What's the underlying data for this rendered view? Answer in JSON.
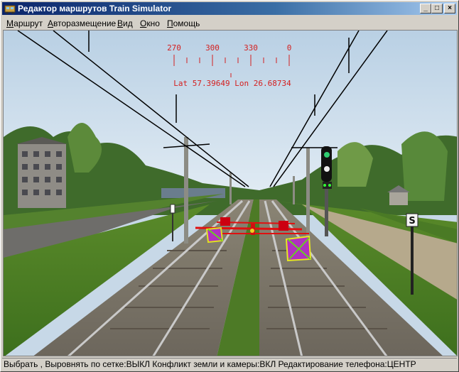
{
  "window": {
    "title": "Редактор маршрутов Train Simulator",
    "controls": {
      "minimize": "_",
      "maximize": "□",
      "close": "×"
    }
  },
  "menu": [
    {
      "label": "Маршрут",
      "hotkey": "М",
      "rest": "аршрут"
    },
    {
      "label": "Авторазмещение",
      "hotkey": "А",
      "rest": "вторазмещение"
    },
    {
      "label": "Вид",
      "hotkey": "В",
      "rest": "ид"
    },
    {
      "label": "Окно",
      "hotkey": "О",
      "rest": "кно"
    },
    {
      "label": "Помощь",
      "hotkey": "П",
      "rest": "омощь"
    }
  ],
  "compass": {
    "headings": [
      "270",
      "300",
      "330",
      "0"
    ],
    "coordinates": "Lat 57.39649 Lon 26.68734",
    "color": "#d42020"
  },
  "scene": {
    "sign_letter": "S"
  },
  "statusbar": {
    "text": "Выбрать , Выровнять по сетке:ВЫКЛ Конфликт земли и камеры:ВКЛ Редактирование телефона:ЦЕНТР"
  }
}
